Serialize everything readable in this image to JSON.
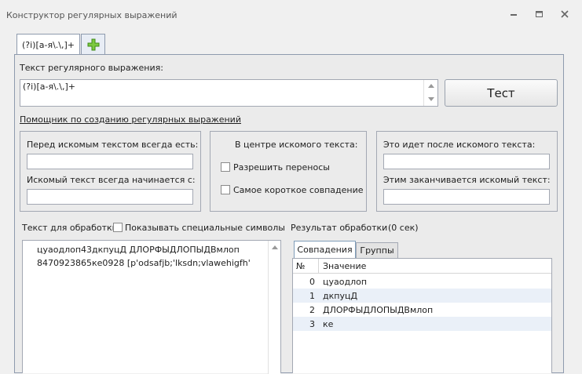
{
  "window": {
    "title": "Конструктор регулярных выражений"
  },
  "tabs": [
    {
      "label": "(?i)[а-я\\.\\,]+"
    }
  ],
  "regex": {
    "label": "Текст регулярного выражения:",
    "value": "(?i)[а-я\\.\\,]+"
  },
  "test_button": {
    "label": "Тест"
  },
  "helper_link": {
    "label": "Помощник по созданию регулярных выражений"
  },
  "helper": {
    "before": {
      "label_always": "Перед искомым текстом всегда есть:",
      "value_always": "",
      "label_starts": "Искомый текст всегда начинается с:",
      "value_starts": ""
    },
    "center": {
      "label": "В центре искомого текста:",
      "allow_wraps": {
        "label": "Разрешить переносы",
        "checked": false
      },
      "shortest": {
        "label": "Самое короткое совпадение",
        "checked": false
      }
    },
    "after": {
      "label_after": "Это идет после искомого текста:",
      "value_after": "",
      "label_ends": "Этим заканчивается искомый текст:",
      "value_ends": ""
    }
  },
  "input_text": {
    "label": "Текст для обработки",
    "show_special": {
      "label": "Показывать специальные символы",
      "checked": false
    },
    "lines": [
      "цуаодлоп43дкпуцД ДЛОРФЫДЛОПЫДВмлоп",
      "8470923865ке0928 [p'odsafjb;'lksdn;vlawehigfh'"
    ]
  },
  "result": {
    "label": "Результат обработки",
    "time": "(0 сек)",
    "tabs": [
      "Совпадения",
      "Группы"
    ],
    "columns": [
      "№",
      "Значение"
    ],
    "rows": [
      {
        "n": "0",
        "value": "цуаодлоп"
      },
      {
        "n": "1",
        "value": "дкпуцД"
      },
      {
        "n": "2",
        "value": "ДЛОРФЫДЛОПЫДВмлоп"
      },
      {
        "n": "3",
        "value": "ке"
      }
    ]
  },
  "colors": {
    "accent_tab": "#5b86c5",
    "add_icon": "#6cbf2e",
    "row_alt": "#eaf0f8"
  }
}
